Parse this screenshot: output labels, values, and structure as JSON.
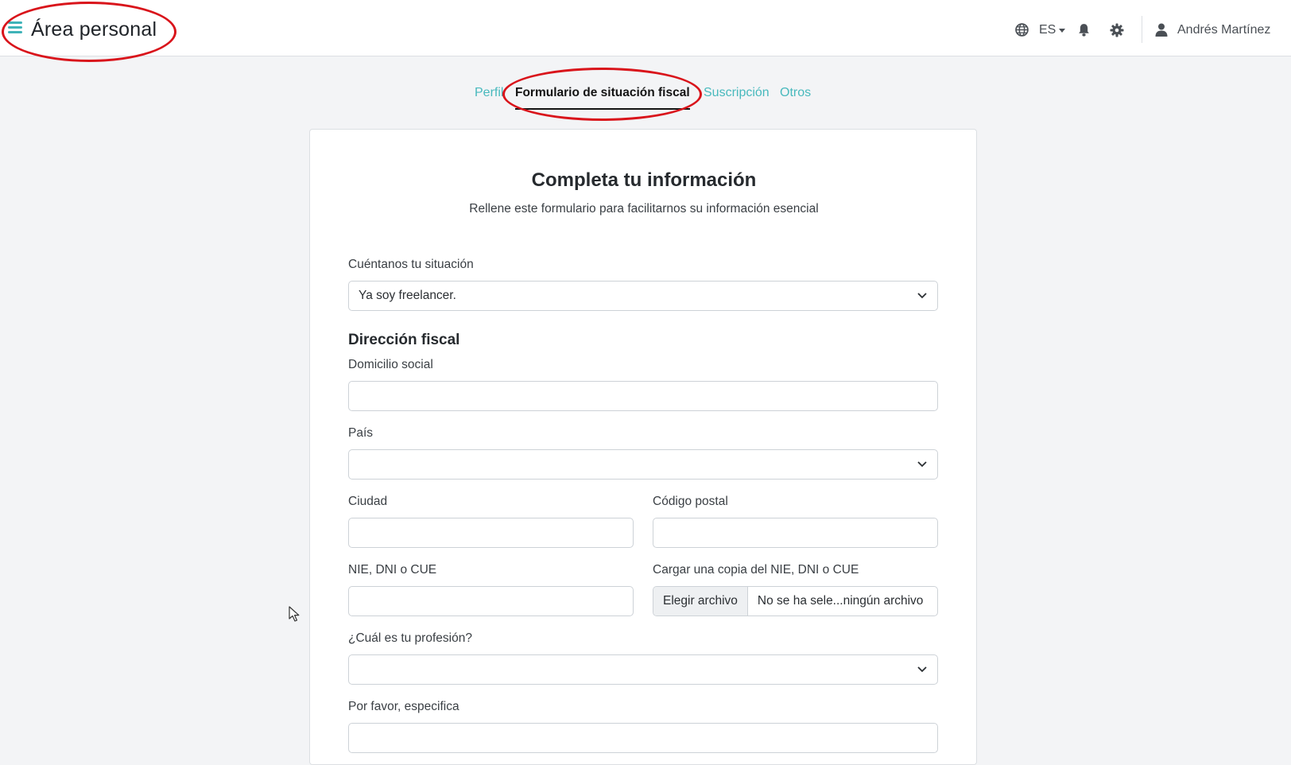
{
  "header": {
    "title": "Área personal",
    "language": "ES",
    "user_name": "Andrés Martínez",
    "icons": [
      "menu-icon",
      "globe-icon",
      "caret-down-icon",
      "bell-icon",
      "gear-icon",
      "user-icon"
    ]
  },
  "tabs": [
    {
      "label": "Perfil",
      "active": false
    },
    {
      "label": "Formulario de situación fiscal",
      "active": true
    },
    {
      "label": "Suscripción",
      "active": false
    },
    {
      "label": "Otros",
      "active": false
    }
  ],
  "form": {
    "title": "Completa tu información",
    "subtitle": "Rellene este formulario para facilitarnos su información esencial",
    "situation": {
      "label": "Cuéntanos tu situación",
      "value": "Ya soy freelancer."
    },
    "address_section": "Dirección fiscal",
    "domicilio": {
      "label": "Domicilio social",
      "value": ""
    },
    "pais": {
      "label": "País",
      "value": ""
    },
    "ciudad": {
      "label": "Ciudad",
      "value": ""
    },
    "codigo_postal": {
      "label": "Código postal",
      "value": ""
    },
    "nie": {
      "label": "NIE, DNI o CUE",
      "value": ""
    },
    "upload": {
      "label": "Cargar una copia del NIE, DNI o CUE",
      "button": "Elegir archivo",
      "status": "No se ha sele...ningún archivo"
    },
    "profesion": {
      "label": "¿Cuál es tu profesión?",
      "value": ""
    },
    "especifica": {
      "label": "Por favor, especifica",
      "value": ""
    }
  },
  "colors": {
    "accent": "#48b9bd",
    "annotation": "#d9141b",
    "background": "#f3f4f6"
  }
}
